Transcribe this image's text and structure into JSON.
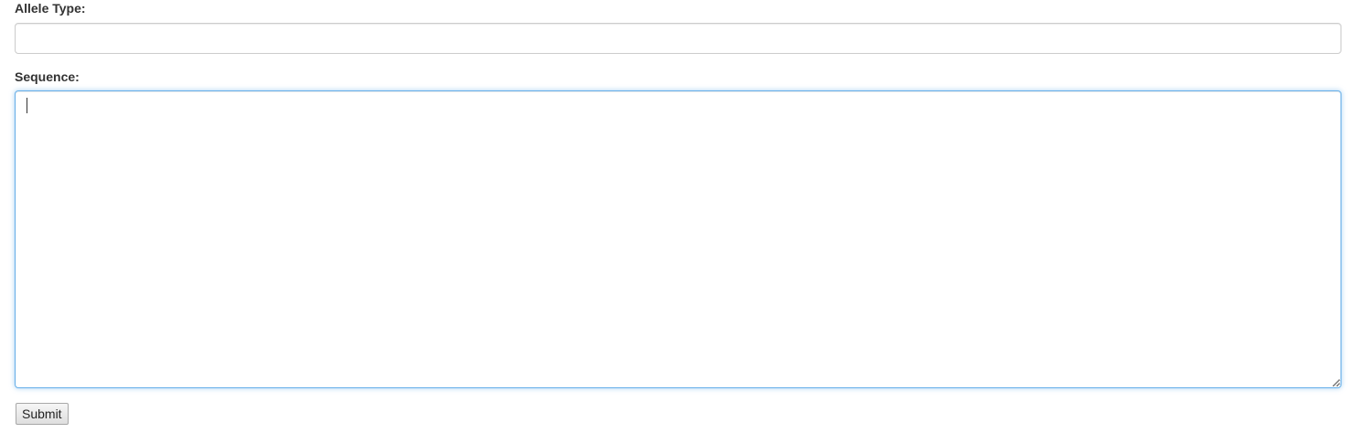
{
  "form": {
    "allele_type": {
      "label": "Allele Type:",
      "value": "",
      "placeholder": ""
    },
    "sequence": {
      "label": "Sequence:",
      "value": "",
      "placeholder": ""
    },
    "submit_label": "Submit"
  },
  "colors": {
    "focus_border": "#66afe9",
    "input_border": "#cccccc",
    "label_text": "#333333"
  }
}
